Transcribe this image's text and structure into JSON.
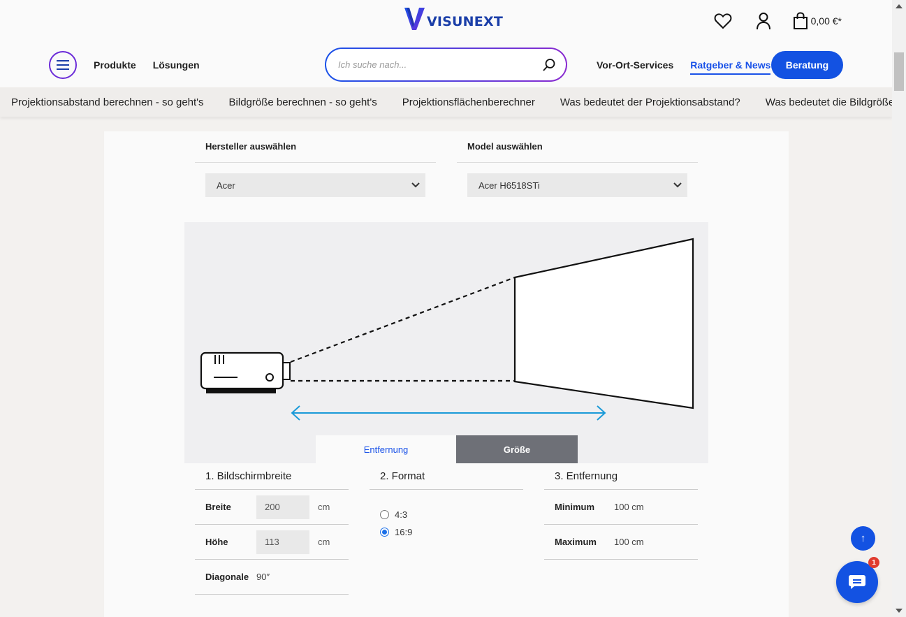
{
  "header": {
    "logo_text": "VISUNEXT",
    "cart_total": "0,00 €*",
    "nav_left": [
      "Produkte",
      "Lösungen"
    ],
    "search_placeholder": "Ich suche nach...",
    "nav_right": [
      "Vor-Ort-Services",
      "Ratgeber & News"
    ],
    "nav_right_active": "Ratgeber & News",
    "cta_label": "Beratung",
    "brand_color": "#1352e2",
    "accent_purple": "#6b2bd8"
  },
  "subnav": {
    "items": [
      "Projektionsabstand berechnen - so geht's",
      "Bildgröße berechnen - so geht's",
      "Projektionsflächenberechner",
      "Was bedeutet der Projektionsabstand?",
      "Was bedeutet die Bildgröße"
    ]
  },
  "selector": {
    "manufacturer_label": "Hersteller auswählen",
    "manufacturer_value": "Acer",
    "model_label": "Model auswählen",
    "model_value": "Acer H6518STi"
  },
  "tabs": {
    "distance": "Entfernung",
    "size": "Größe",
    "active": "Entfernung"
  },
  "screen_width": {
    "title": "1. Bildschirmbreite",
    "width_label": "Breite",
    "width_value": "200",
    "height_label": "Höhe",
    "height_value": "113",
    "unit": "cm",
    "diagonal_label": "Diagonale",
    "diagonal_value": "90″"
  },
  "format": {
    "title": "2. Format",
    "options": [
      "4:3",
      "16:9"
    ],
    "selected": "16:9"
  },
  "distance": {
    "title": "3. Entfernung",
    "min_label": "Minimum",
    "min_value": "100 cm",
    "max_label": "Maximum",
    "max_value": "100 cm"
  },
  "widgets": {
    "to_top": "↑",
    "chat_badge": "1"
  }
}
